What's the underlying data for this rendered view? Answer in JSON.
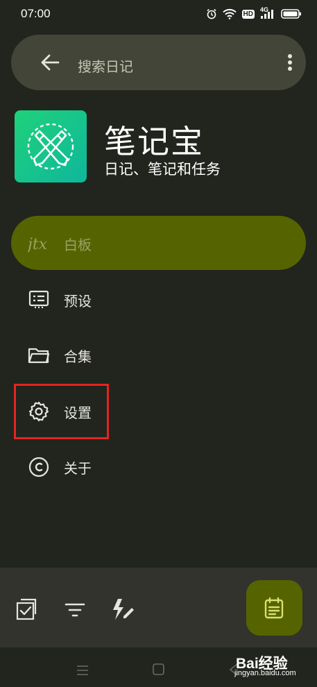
{
  "status_bar": {
    "time": "07:00",
    "icons": [
      "alarm-icon",
      "wifi-icon",
      "hd-badge",
      "signal-4g-icon",
      "battery-icon"
    ],
    "hd_label": "HD",
    "network_label": "4G"
  },
  "search": {
    "placeholder": "搜索日记",
    "back_icon": "arrow-left-icon",
    "more_icon": "more-vert-icon"
  },
  "app": {
    "name": "笔记宝",
    "subtitle": "日记、笔记和任务",
    "logo_icon": "crossed-pencils-icon"
  },
  "menu": {
    "items": [
      {
        "label": "白板",
        "icon": "jtx-logo-icon",
        "active": true
      },
      {
        "label": "预设",
        "icon": "preset-list-icon",
        "active": false
      },
      {
        "label": "合集",
        "icon": "folder-icon",
        "active": false
      },
      {
        "label": "设置",
        "icon": "gear-icon",
        "active": false,
        "highlighted": true
      },
      {
        "label": "关于",
        "icon": "copyright-icon",
        "active": false
      }
    ]
  },
  "bottom_bar": {
    "buttons": [
      "checklist-icon",
      "filter-icon",
      "quick-add-icon"
    ],
    "fab_icon": "journal-add-icon"
  },
  "nav_bar": {
    "buttons": [
      "menu-icon",
      "home-icon",
      "back-icon"
    ]
  },
  "watermark": {
    "brand": "Bai经验",
    "url": "jingyan.baidu.com"
  },
  "colors": {
    "background": "#22241e",
    "search_bar": "#434538",
    "active_item": "#566400",
    "highlight": "#e3261f",
    "logo_green": "#1fd17a",
    "bottom_bar": "#31332c"
  }
}
